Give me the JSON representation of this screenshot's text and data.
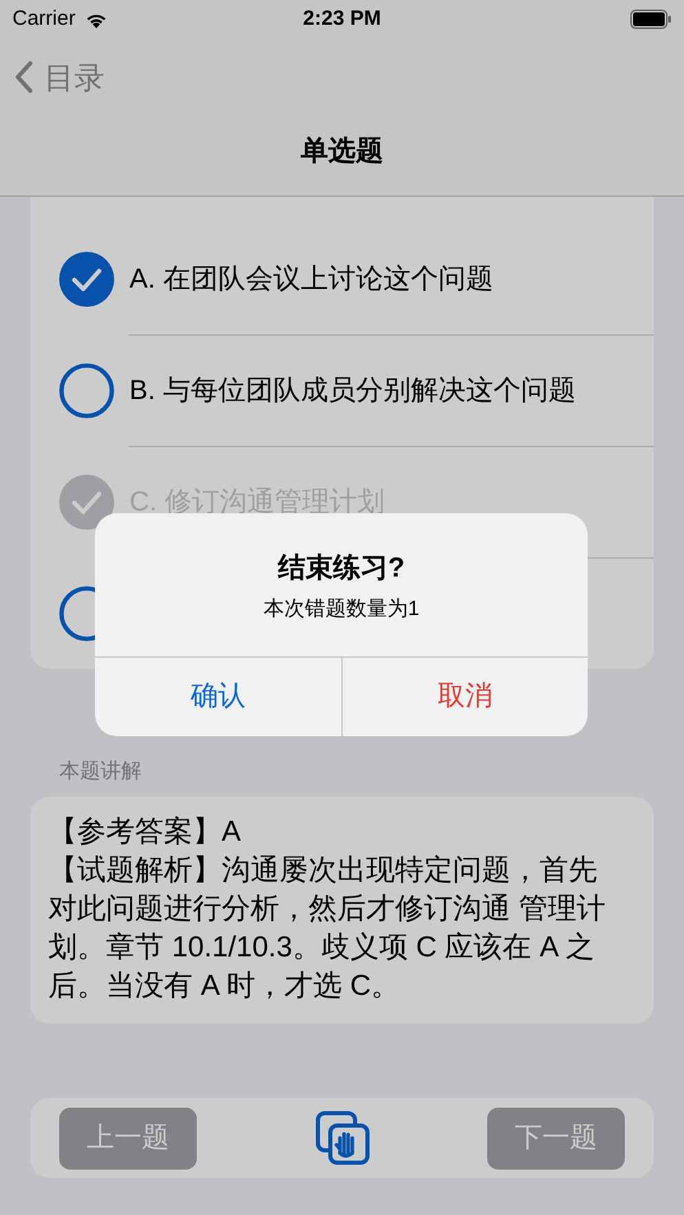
{
  "status_bar": {
    "carrier": "Carrier",
    "time": "2:23 PM"
  },
  "nav": {
    "back": "目录",
    "title": "单选题"
  },
  "options": [
    {
      "label": "A. 在团队会议上讨论这个问题",
      "selected": true,
      "disabled": false
    },
    {
      "label": "B. 与每位团队成员分别解决这个问题",
      "selected": false,
      "disabled": false
    },
    {
      "label": "C. 修订沟通管理计划",
      "selected": true,
      "disabled": true
    },
    {
      "selected": false,
      "disabled": false
    }
  ],
  "explanation": {
    "heading": "本题讲解",
    "answer": "【参考答案】A",
    "analysis": "【试题解析】沟通屡次出现特定问题，首先对此问题进行分析，然后才修订沟通 管理计划。章节 10.1/10.3。歧义项 C 应该在 A 之后。当没有 A 时，才选 C。"
  },
  "toolbar": {
    "prev": {
      "label": "上一题",
      "disabled": true
    },
    "next": {
      "label": "下一题",
      "disabled": true
    }
  },
  "alert": {
    "title": "结束练习?",
    "message": "本次错题数量为1",
    "buttons": [
      {
        "label": "确认",
        "kind": "default"
      },
      {
        "label": "取消",
        "kind": "destructive"
      }
    ]
  }
}
